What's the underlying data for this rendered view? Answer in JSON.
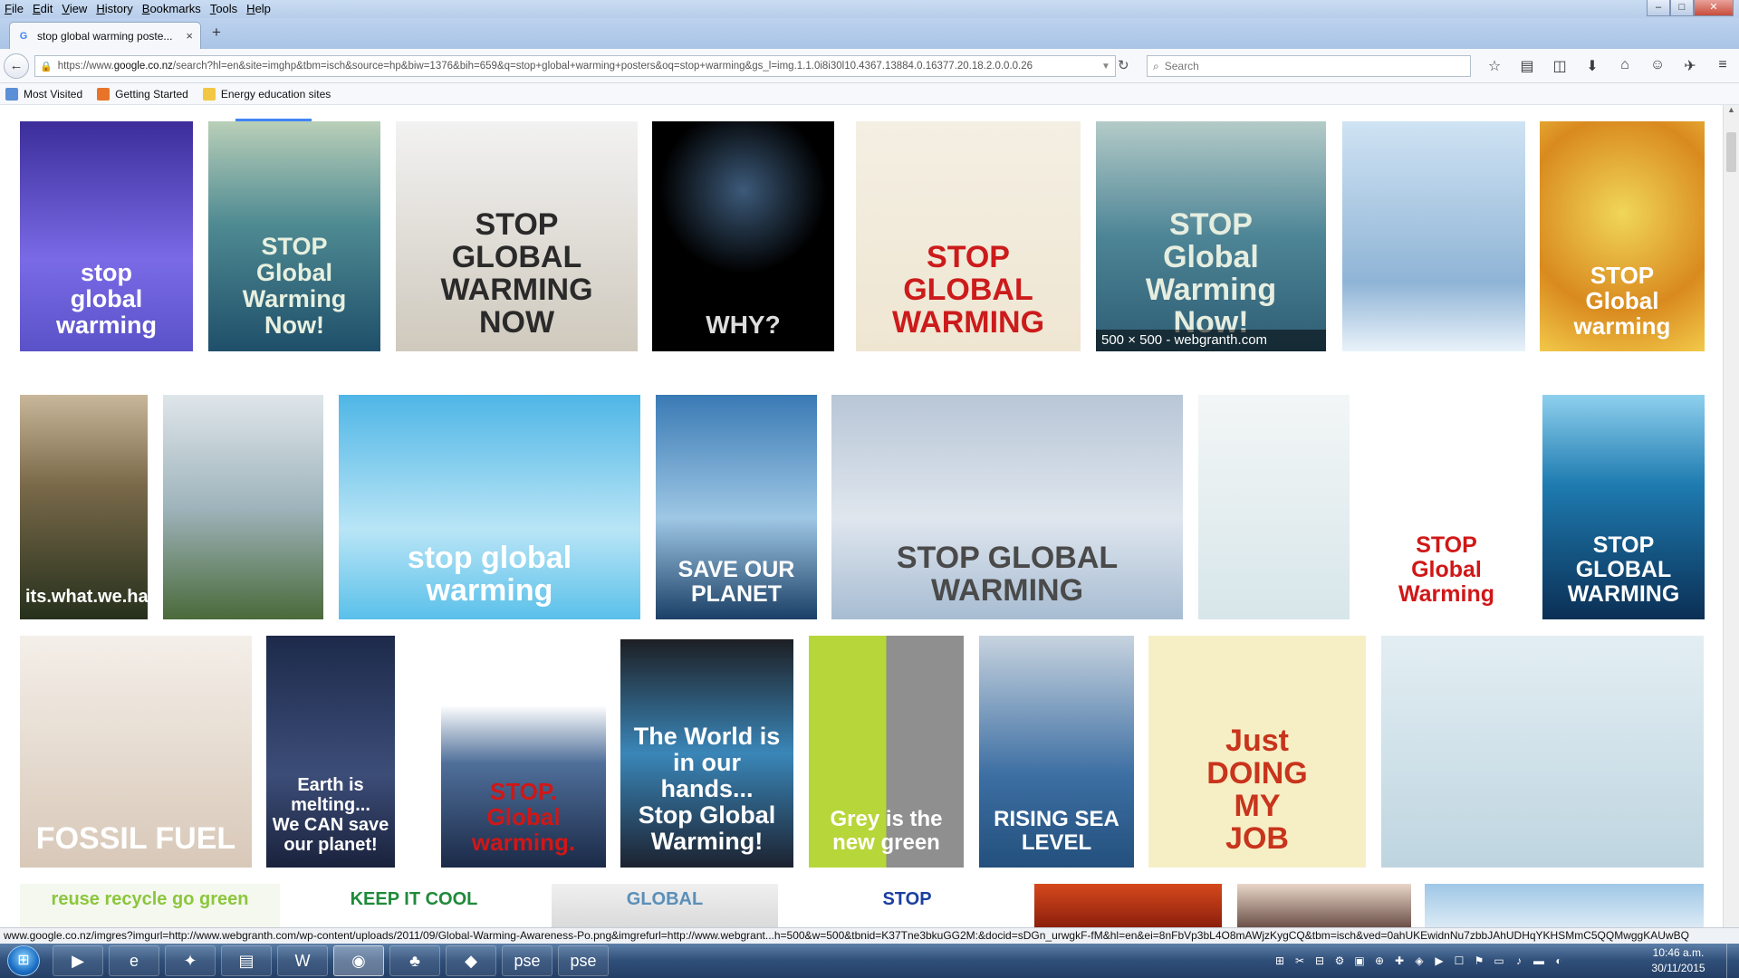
{
  "menu": [
    "File",
    "Edit",
    "View",
    "History",
    "Bookmarks",
    "Tools",
    "Help"
  ],
  "window_controls": {
    "minimize": "–",
    "maximize": "□",
    "close": "✕"
  },
  "tab": {
    "title": "stop global warming poste...",
    "close": "×",
    "favicon": "G"
  },
  "new_tab": "+",
  "nav": {
    "back": "←",
    "lock": "🔒",
    "url_prefix": "https://www.",
    "url_domain": "google.co.nz",
    "url_rest": "/search?hl=en&site=imghp&tbm=isch&source=hp&biw=1376&bih=659&q=stop+global+warming+posters&oq=stop+warming&gs_l=img.1.1.0i8i30l10.4367.13884.0.16377.20.18.2.0.0.0.26",
    "reload": "↻",
    "search_placeholder": "Search",
    "icons": [
      "star-icon",
      "reading-list-icon",
      "pocket-icon",
      "download-icon",
      "home-icon",
      "chat-icon",
      "share-icon",
      "menu-icon"
    ]
  },
  "bookmarks": [
    {
      "label": "Most Visited",
      "color": "#5b8fd6"
    },
    {
      "label": "Getting Started",
      "color": "#e8742a"
    },
    {
      "label": "Energy education sites",
      "color": "#f2c744"
    }
  ],
  "images": [
    {
      "name": "stop-global-warming-hairdryer",
      "caption": "stop\nglobal warming",
      "bg": "linear-gradient(#3b2e9a,#7a6ae6 60%,#5a52c8)",
      "fg": "#ffffff"
    },
    {
      "name": "stop-global-warming-sea",
      "caption": "STOP\nGlobal\nWarming\nNow!",
      "bg": "linear-gradient(#b9cfb8,#4e8a92 45%,#1f4f6a)",
      "fg": "#e8f0e0"
    },
    {
      "name": "stop-global-warming-now-letters",
      "caption": "STOP\nGLOBAL\nWARMING\nNOW",
      "bg": "linear-gradient(#f2f2f2,#cfc9bd)",
      "fg": "#2a2a2a"
    },
    {
      "name": "why-globe-candle",
      "caption": "WHY?",
      "bg": "radial-gradient(circle at 50% 30%,#3c5a7a,#000 45%)",
      "fg": "#dddddd"
    },
    {
      "name": "stop-sign-earth",
      "caption": "STOP\nGLOBAL\nWARMING",
      "bg": "linear-gradient(#f4efe3,#efe6d2)",
      "fg": "#cc1b1b"
    },
    {
      "name": "stop-global-warming-webgranth",
      "caption": "STOP\nGlobal\nWarming\nNow!",
      "bg": "linear-gradient(#b4cbc8,#4d8596 50%,#2e5d74)",
      "fg": "#e6eee0",
      "info": "500 × 500 - webgranth.com"
    },
    {
      "name": "penguin-lamp",
      "caption": "",
      "bg": "linear-gradient(#cfe3f3,#8fb4d6 70%,#e9f2fa)",
      "fg": "#222222"
    },
    {
      "name": "one-tree-against-global-warming",
      "caption": "STOP\nGlobal warming",
      "bg": "radial-gradient(circle at 50% 40%,#f0d65a,#d98a1e 60%,#f2c94a)",
      "fg": "#ffffff"
    },
    {
      "name": "jar-its-what-we-have-left",
      "caption": "its.what.we.have.left.",
      "bg": "linear-gradient(#c8b79a,#7a6a4a 40%,#26301c)",
      "fg": "#ffffff"
    },
    {
      "name": "hourglass-city",
      "caption": "",
      "bg": "linear-gradient(#dfe6ea,#9fb4bc 50%,#4a6a3a)",
      "fg": "#333333"
    },
    {
      "name": "floating-island-help",
      "caption": "stop global\nwarming",
      "bg": "linear-gradient(#4fb6e6,#b9e5f6 60%,#5ac0ea)",
      "fg": "#ffffff"
    },
    {
      "name": "save-our-planet-bear",
      "caption": "SAVE OUR\nPLANET",
      "bg": "linear-gradient(#3a7ab5,#9ec7e4 55%,#1b3f66)",
      "fg": "#ffffff"
    },
    {
      "name": "stop-global-warming-polar-bear",
      "caption": "STOP GLOBAL WARMING",
      "bg": "linear-gradient(#b8c6d6,#dfe6ee 55%,#a7bcd2)",
      "fg": "#4a4a4a"
    },
    {
      "name": "tree-glass-water",
      "caption": "",
      "bg": "linear-gradient(#f3f6f6,#d7e6ea)",
      "fg": "#333333"
    },
    {
      "name": "stop-global-warming-sad-earth",
      "caption": "STOP\nGlobal Warming",
      "bg": "#ffffff",
      "fg": "#d01717"
    },
    {
      "name": "underwater-skyscraper",
      "caption": "STOP\nGLOBAL\nWARMING",
      "bg": "linear-gradient(#8ed0ee,#1e7bb0 40%,#0b2f55)",
      "fg": "#ffffff"
    },
    {
      "name": "fossil-fuel-burning-earth",
      "caption": "FOSSIL FUEL",
      "bg": "linear-gradient(#f4efe9,#d8c8b8)",
      "fg": "#ffffff"
    },
    {
      "name": "earth-ice-cream-cone",
      "caption": "Earth is melting...\nWe CAN save our planet!",
      "bg": "linear-gradient(#1d2a4a,#3c4d78 60%,#1a223c)",
      "fg": "#ffffff"
    },
    {
      "name": "stop-global-warming-wave",
      "caption": "STOP.\nGlobal warming.",
      "bg": "linear-gradient(#ffffff 30%,#4f6f9a 55%,#1b2a48)",
      "fg": "#d01717"
    },
    {
      "name": "world-in-our-hands",
      "caption": "The World is in our hands...\nStop Global Warming!",
      "bg": "linear-gradient(#1d1f24,#3a86b8 50%,#1c2230)",
      "fg": "#ffffff"
    },
    {
      "name": "grey-is-the-new-green",
      "caption": "Grey is the new green",
      "bg": "linear-gradient(90deg,#b7d63a 50%,#8f8f8f 50%)",
      "fg": "#ffffff"
    },
    {
      "name": "panda-rising-sea-level",
      "caption": "RISING SEA LEVEL",
      "bg": "linear-gradient(#c7d3df,#3d6fa3 60%,#23507d)",
      "fg": "#ffffff"
    },
    {
      "name": "just-doing-my-job-earth",
      "caption": "Just\nDOING\nMY\nJOB",
      "bg": "#f6efc6",
      "fg": "#c8341c"
    },
    {
      "name": "fish-gas-mask",
      "caption": "",
      "bg": "linear-gradient(#e3eef3,#bed5e0)",
      "fg": "#333333"
    },
    {
      "name": "reuse-recycle-go-green",
      "caption": "reuse recycle go green",
      "bg": "#f4f8ee",
      "fg": "#8cc63e"
    },
    {
      "name": "keep-it-cool",
      "caption": "KEEP IT COOL",
      "bg": "#ffffff",
      "fg": "#1f8a3a"
    },
    {
      "name": "global-warming-blue",
      "caption": "GLOBAL",
      "bg": "linear-gradient(#f0f0f0,#dadada)",
      "fg": "#5a8fb8"
    },
    {
      "name": "stop-blue",
      "caption": "STOP",
      "bg": "#ffffff",
      "fg": "#1b3fa0"
    },
    {
      "name": "fire-red",
      "caption": "",
      "bg": "linear-gradient(#d6491c,#8b1f0c)",
      "fg": "#ffffff"
    },
    {
      "name": "eye-lashes",
      "caption": "",
      "bg": "linear-gradient(#e9d6c8,#6b5048)",
      "fg": "#ffffff"
    },
    {
      "name": "ocean-light",
      "caption": "",
      "bg": "linear-gradient(#9fc7e6,#dbeaf5)",
      "fg": "#ffffff"
    }
  ],
  "status_url": "www.google.co.nz/imgres?imgurl=http://www.webgranth.com/wp-content/uploads/2011/09/Global-Warming-Awareness-Po.png&imgrefurl=http://www.webgrant...h=500&w=500&tbnid=K37Tne3bkuGG2M:&docid=sDGn_urwgkF-fM&hl=en&ei=8nFbVp3bL4O8mAWjzKygCQ&tbm=isch&ved=0ahUKEwidnNu7zbbJAhUDHqYKHSMmC5QQMwggKAUwBQ",
  "taskbar": {
    "start": "⊞",
    "items": [
      "▶",
      "e",
      "✦",
      "▤",
      "W",
      "◉",
      "♣",
      "◆",
      "pse",
      "pse"
    ],
    "tray_icons": [
      "⊞",
      "✂",
      "⊟",
      "⚙",
      "▣",
      "⊕",
      "✚",
      "◈",
      "▶",
      "☐",
      "⚑",
      "▭",
      "♪",
      "▬",
      "◐"
    ],
    "time": "10:46 a.m.",
    "date": "30/11/2015"
  }
}
